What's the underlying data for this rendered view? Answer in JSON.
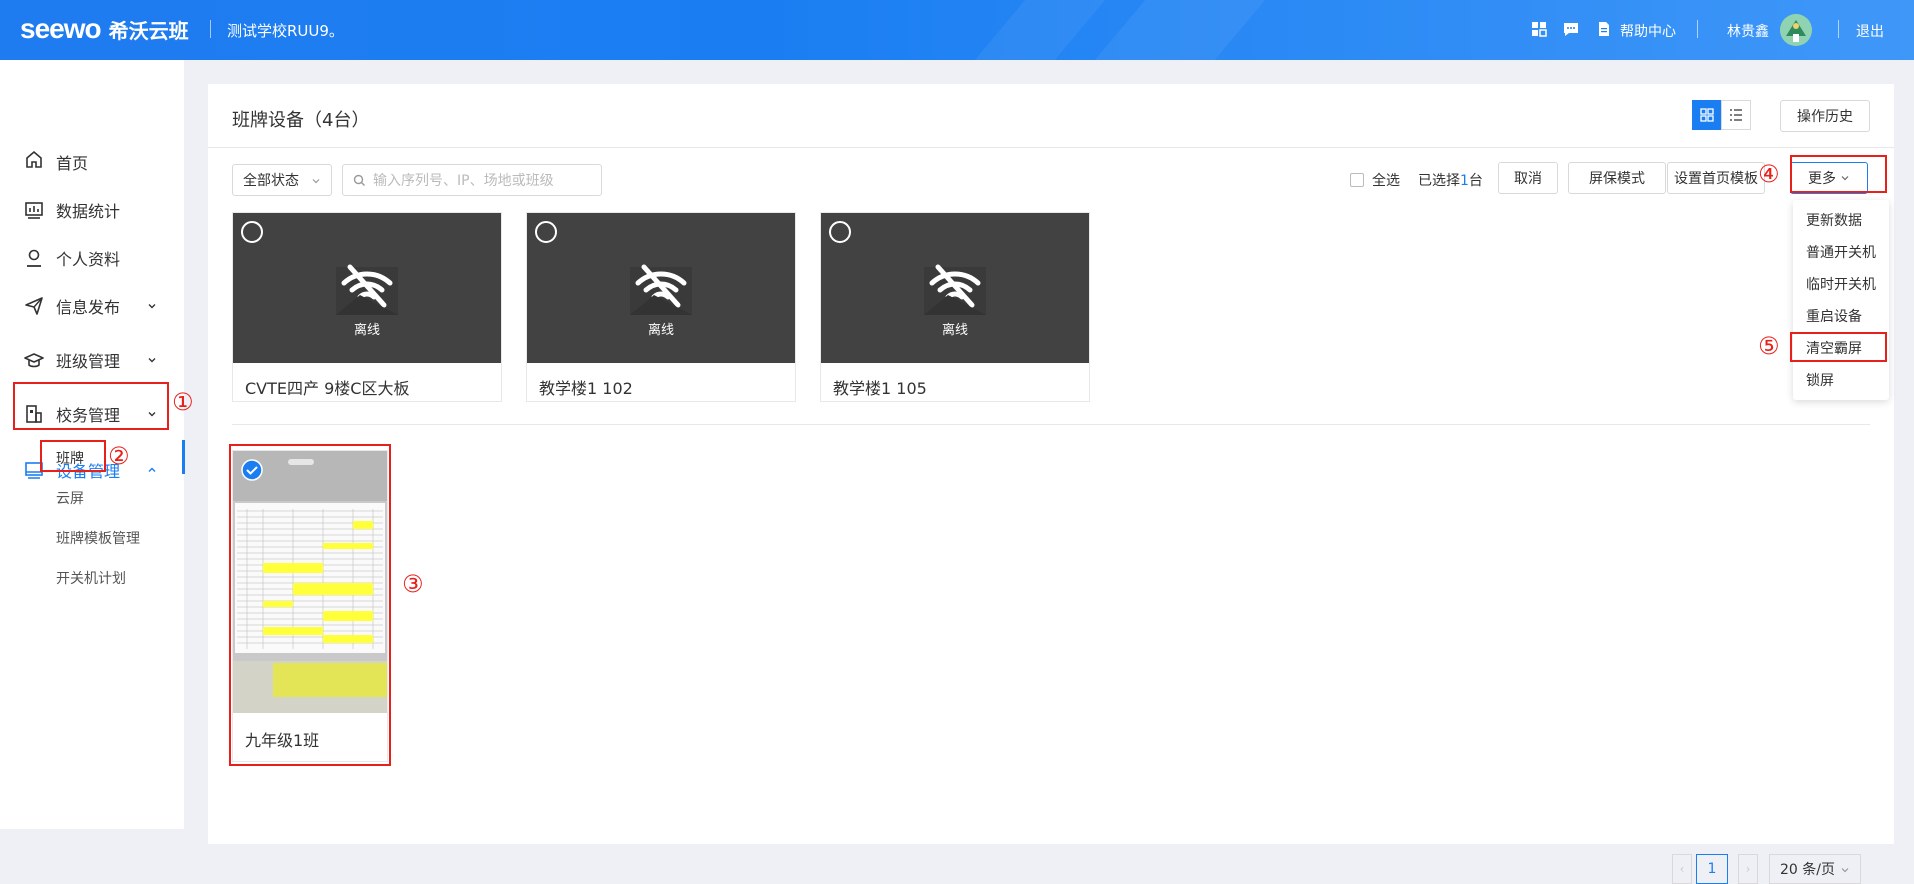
{
  "topbar": {
    "brand": "seewo",
    "product": "希沃云班",
    "school": "测试学校RUU9。",
    "help": "帮助中心",
    "user": "林贵鑫",
    "logout": "退出",
    "icons": [
      "grid-icon",
      "message-icon",
      "document-icon"
    ]
  },
  "sidebar": {
    "items": [
      {
        "label": "首页",
        "icon": "home-icon"
      },
      {
        "label": "数据统计",
        "icon": "chart-icon"
      },
      {
        "label": "个人资料",
        "icon": "user-icon"
      },
      {
        "label": "信息发布",
        "icon": "send-icon"
      },
      {
        "label": "班级管理",
        "icon": "graduation-icon"
      },
      {
        "label": "校务管理",
        "icon": "office-icon"
      },
      {
        "label": "设备管理",
        "icon": "monitor-icon"
      }
    ],
    "sub_items": [
      "班牌",
      "云屏",
      "班牌模板管理",
      "开关机计划"
    ]
  },
  "main": {
    "title": "班牌设备（4台）",
    "history": "操作历史",
    "status_filter": "全部状态",
    "search_placeholder": "输入序列号、IP、场地或班级",
    "select_all": "全选",
    "selected_prefix": "已选择",
    "selected_count": "1",
    "selected_suffix": "台",
    "cancel": "取消",
    "screensaver": "屏保模式",
    "home_template": "设置首页模板",
    "more": "更多",
    "offline_label": "离线",
    "devices": [
      {
        "name": "CVTE四产 9楼C区大板",
        "status": "offline"
      },
      {
        "name": "教学楼1 102",
        "status": "offline"
      },
      {
        "name": "教学楼1 105",
        "status": "offline"
      },
      {
        "name": "九年级1班",
        "status": "online",
        "selected": true
      }
    ],
    "more_menu": [
      "更新数据",
      "普通开关机",
      "临时开关机",
      "重启设备",
      "清空霸屏",
      "锁屏"
    ],
    "pagination": {
      "page": "1",
      "page_size": "20 条/页"
    }
  },
  "annotations": [
    "①",
    "②",
    "③",
    "④",
    "⑤"
  ],
  "colors": {
    "primary": "#1a7ef2",
    "annotation": "#e8201c",
    "offline_bg": "#424242"
  }
}
